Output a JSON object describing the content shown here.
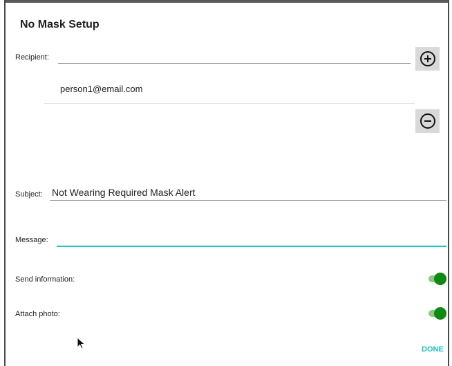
{
  "dialog": {
    "title": "No Mask Setup"
  },
  "recipient": {
    "label": "Recipient:",
    "input_value": "",
    "add_button_icon": "plus-circle-icon",
    "remove_button_icon": "minus-circle-icon",
    "list": [
      "person1@email.com"
    ]
  },
  "subject": {
    "label": "Subject:",
    "value": "Not Wearing Required Mask Alert"
  },
  "message": {
    "label": "Message:",
    "value": ""
  },
  "send_information": {
    "label": "Send information:",
    "enabled": true
  },
  "attach_photo": {
    "label": "Attach photo:",
    "enabled": true
  },
  "actions": {
    "done_label": "DONE"
  },
  "colors": {
    "accent": "#1cc7c3",
    "toggle_on": "#0e8a13",
    "toggle_track": "#8dc78b",
    "button_bg": "#d9d9d9"
  }
}
